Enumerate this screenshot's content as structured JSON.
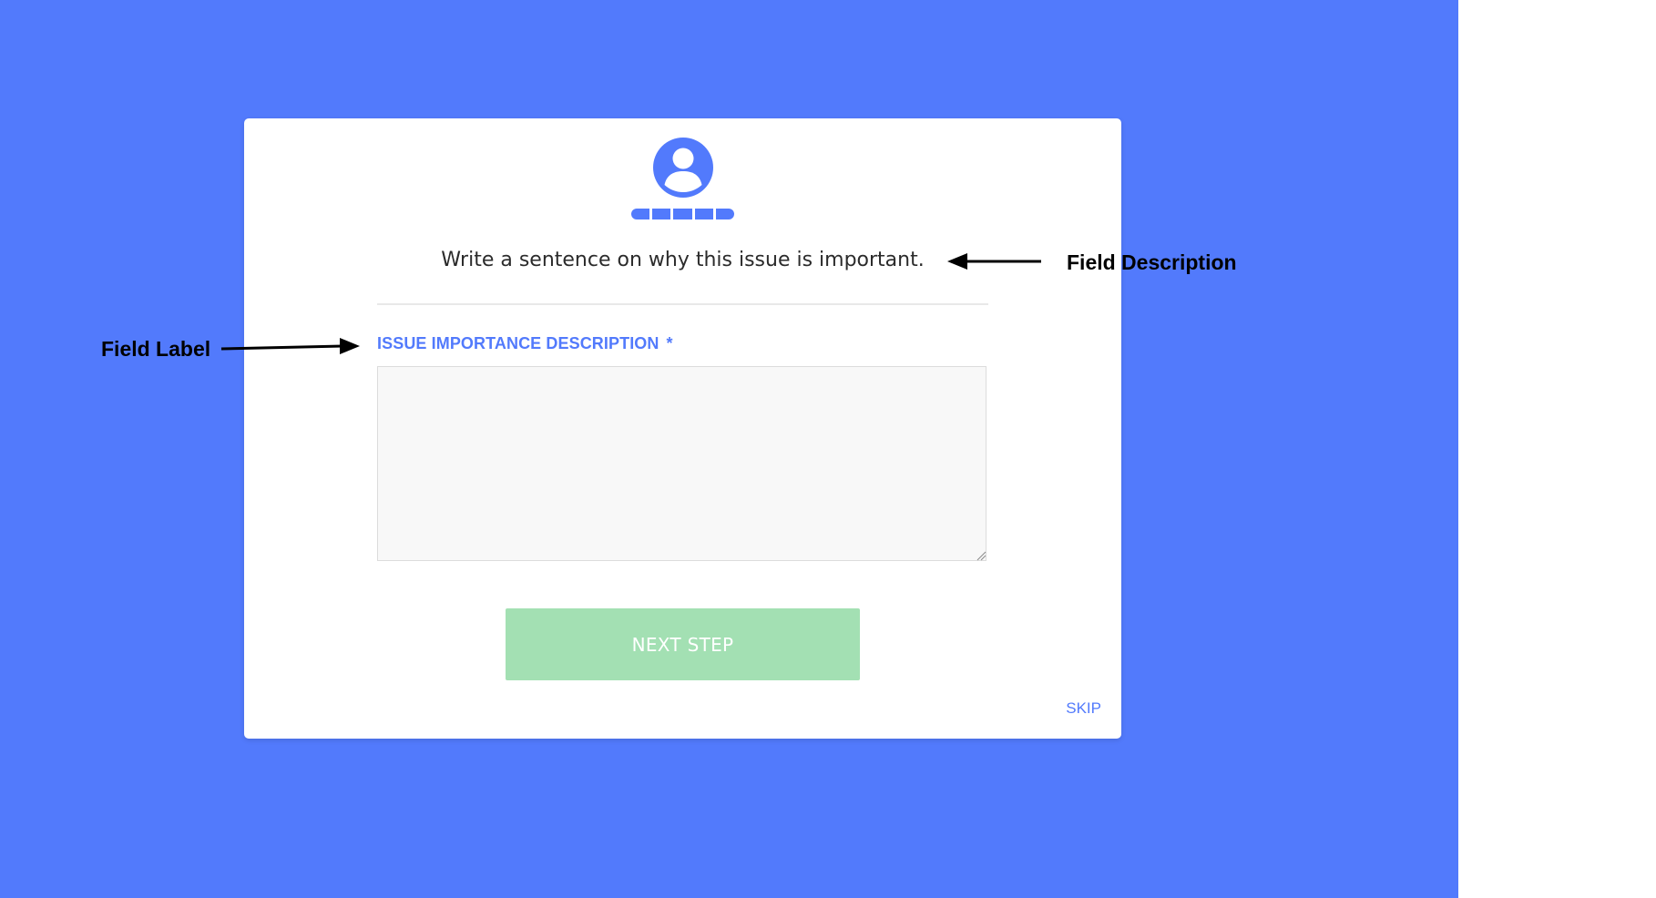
{
  "colors": {
    "background": "#527afc",
    "accent": "#527afc",
    "button": "#a3e0b3"
  },
  "header": {
    "icon": "user-avatar-icon",
    "progress_steps": 5
  },
  "form": {
    "description": "Write a sentence on why this issue is important.",
    "field_label": "ISSUE IMPORTANCE DESCRIPTION",
    "required_marker": "*",
    "field_value": "",
    "next_label": "NEXT STEP",
    "skip_label": "SKIP"
  },
  "annotations": {
    "field_description": "Field Description",
    "field_label": "Field Label"
  }
}
